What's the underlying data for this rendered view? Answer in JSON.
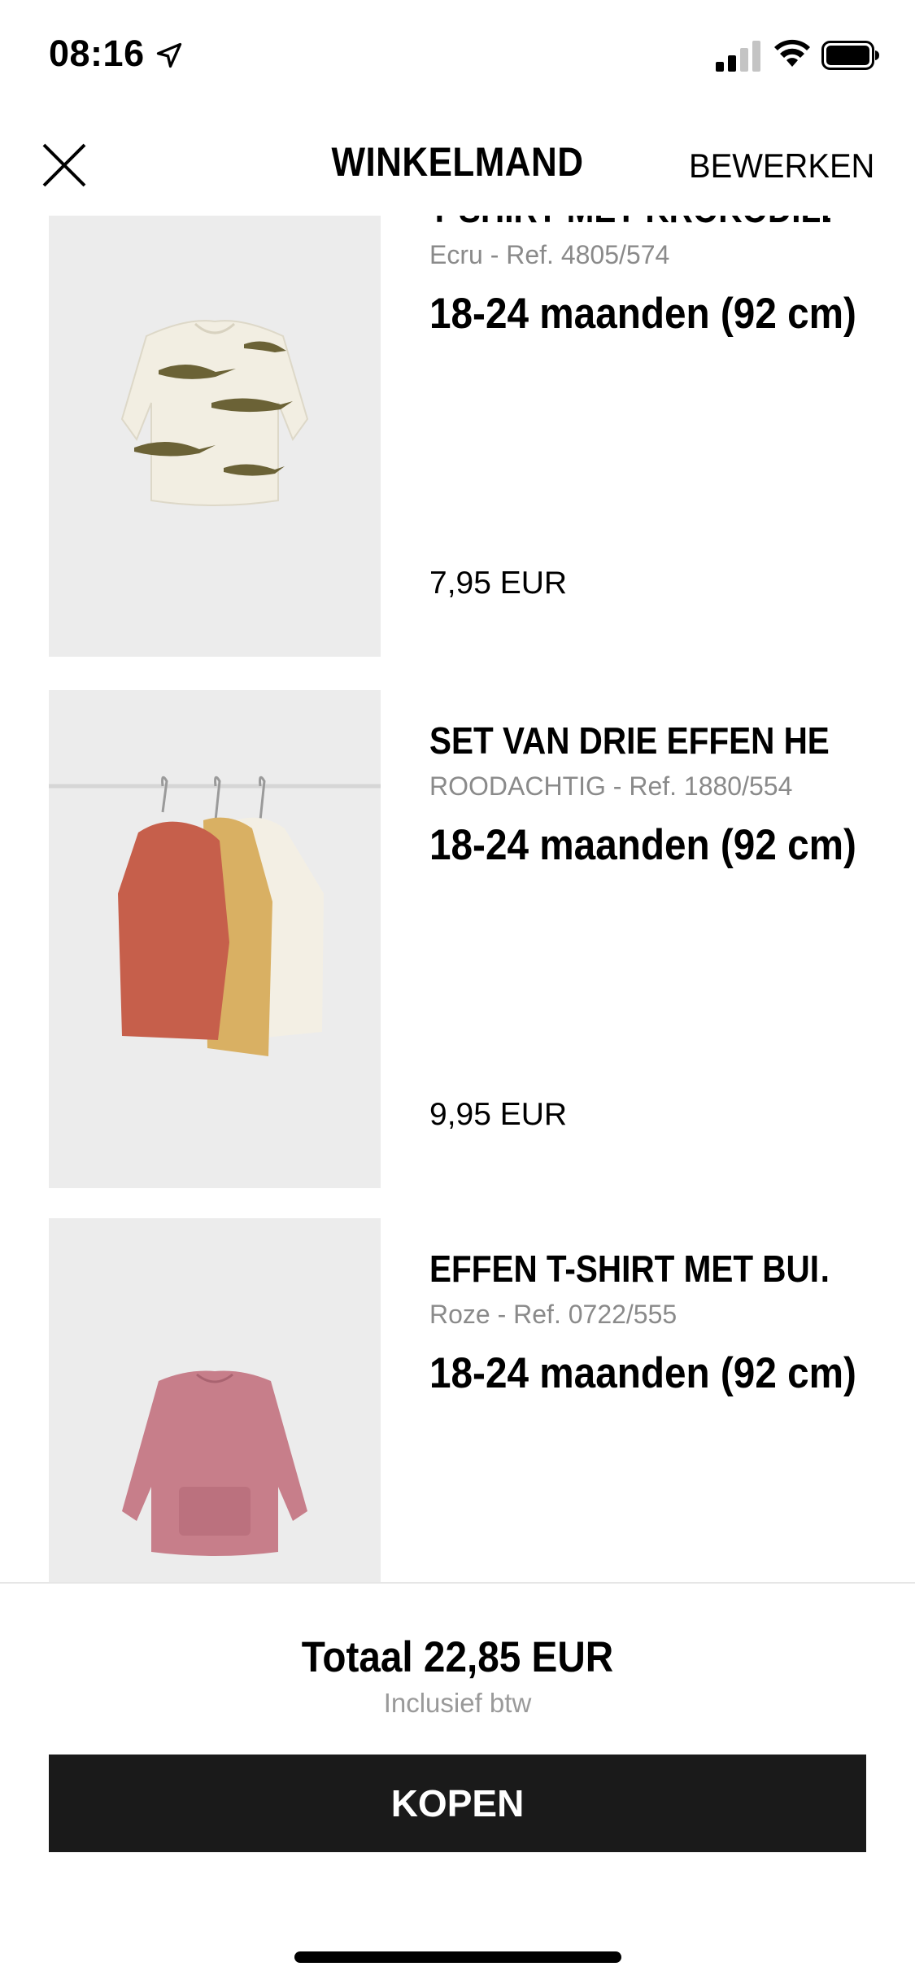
{
  "status_bar": {
    "time": "08:16"
  },
  "nav": {
    "title": "WINKELMAND",
    "edit_label": "BEWERKEN"
  },
  "items": [
    {
      "name": "T-SHIRT MET KROKODILLEN",
      "ref": "Ecru - Ref. 4805/574",
      "size": "18-24 maanden (92 cm)",
      "price": "7,95 EUR"
    },
    {
      "name": "SET VAN DRIE EFFEN HE…",
      "ref": "ROODACHTIG - Ref. 1880/554",
      "size": "18-24 maanden (92 cm)",
      "price": "9,95 EUR"
    },
    {
      "name": "EFFEN T-SHIRT MET BUI…",
      "ref": "Roze - Ref. 0722/555",
      "size": "18-24 maanden (92 cm)",
      "price": ""
    }
  ],
  "footer": {
    "total": "Totaal 22,85 EUR",
    "vat_note": "Inclusief btw",
    "buy_label": "KOPEN"
  }
}
